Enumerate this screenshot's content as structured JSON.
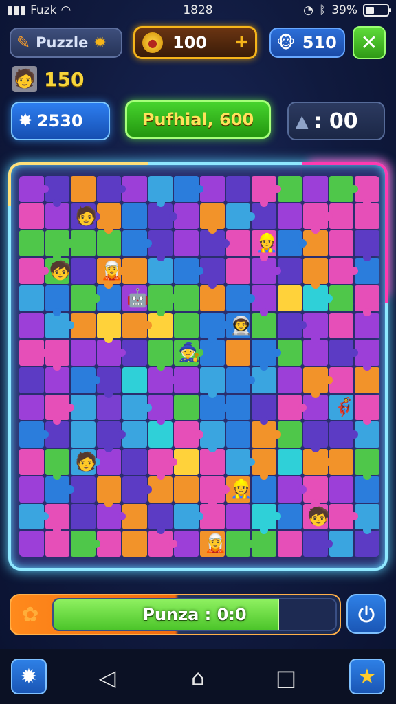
{
  "status_bar": {
    "carrier": "Fuzk",
    "time": "1828",
    "battery_text": "39%",
    "battery_level": 0.39
  },
  "header": {
    "puzzle_label": "Puzzle",
    "coins": "100",
    "gems": "510",
    "player_level": "150"
  },
  "stats": {
    "score": "2530",
    "mode_label": "Pufhial, 600",
    "timer": ": 00"
  },
  "board": {
    "colors": [
      "#9c3fd8",
      "#5c3bc4",
      "#e64fb8",
      "#3aa5e0",
      "#2b7ddc",
      "#f2932a",
      "#4fc74a",
      "#2fd0d8",
      "#ffd23a",
      "#7a3fd0"
    ],
    "grid": [
      [
        0,
        1,
        5,
        1,
        0,
        3,
        4,
        0,
        1,
        2,
        6,
        0,
        6,
        2
      ],
      [
        2,
        0,
        1,
        5,
        4,
        1,
        0,
        5,
        3,
        1,
        0,
        2,
        2,
        2
      ],
      [
        6,
        6,
        6,
        6,
        4,
        1,
        0,
        1,
        2,
        2,
        4,
        5,
        2,
        1
      ],
      [
        2,
        6,
        1,
        5,
        5,
        3,
        4,
        1,
        2,
        0,
        1,
        5,
        2,
        4
      ],
      [
        3,
        4,
        6,
        4,
        0,
        6,
        6,
        5,
        4,
        0,
        8,
        7,
        6,
        2
      ],
      [
        0,
        3,
        5,
        8,
        5,
        8,
        6,
        4,
        4,
        6,
        1,
        0,
        2,
        0
      ],
      [
        2,
        2,
        0,
        0,
        1,
        6,
        6,
        4,
        5,
        4,
        6,
        0,
        1,
        0
      ],
      [
        1,
        0,
        4,
        1,
        7,
        0,
        0,
        3,
        4,
        3,
        0,
        5,
        2,
        5
      ],
      [
        0,
        2,
        3,
        9,
        3,
        0,
        6,
        4,
        4,
        1,
        2,
        0,
        3,
        2
      ],
      [
        4,
        1,
        3,
        1,
        3,
        7,
        2,
        3,
        4,
        5,
        6,
        1,
        1,
        3
      ],
      [
        2,
        6,
        3,
        0,
        1,
        2,
        8,
        2,
        3,
        5,
        7,
        5,
        5,
        6
      ],
      [
        0,
        4,
        1,
        5,
        1,
        5,
        5,
        2,
        5,
        4,
        0,
        2,
        0,
        4
      ],
      [
        3,
        2,
        1,
        0,
        5,
        1,
        3,
        2,
        0,
        7,
        4,
        2,
        2,
        3
      ],
      [
        0,
        2,
        6,
        2,
        5,
        2,
        0,
        5,
        6,
        6,
        2,
        1,
        3,
        1
      ]
    ],
    "characters": [
      "🧑",
      "👷",
      "🧒",
      "🧝",
      "🤖",
      "👨‍🚀",
      "🧙",
      "🦸"
    ]
  },
  "progress": {
    "label": "Punza : 0:0",
    "fraction": 0.8
  },
  "nav": {
    "back": "◁",
    "home": "⌂",
    "recents": "□"
  },
  "icons": {
    "puzzle": "puzzle-piece-icon",
    "gear": "gear-icon",
    "coin": "coin-icon",
    "gem_face": "monkey-face-icon",
    "close": "close-icon",
    "score_badge": "star-badge-icon",
    "timer": "hat-icon",
    "power": "power-icon",
    "settings": "settings-icon",
    "star": "star-icon"
  }
}
